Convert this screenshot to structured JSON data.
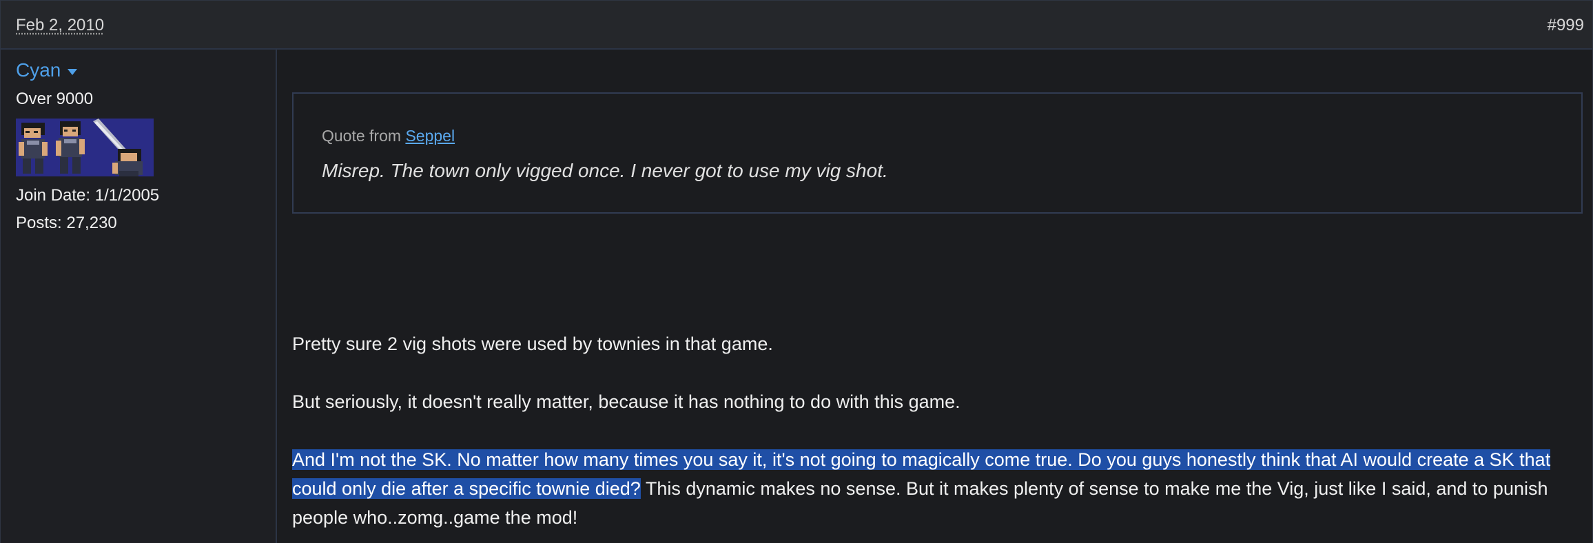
{
  "header": {
    "date": "Feb 2, 2010",
    "post_number": "#999"
  },
  "user": {
    "name": "Cyan",
    "rank": "Over 9000",
    "join_date": "Join Date: 1/1/2005",
    "posts": "Posts: 27,230"
  },
  "quote": {
    "prefix": "Quote from ",
    "author": "Seppel",
    "text": "Misrep. The town only vigged once. I never got to use my vig shot."
  },
  "body": {
    "para1": "Pretty sure 2 vig shots were used by townies in that game.",
    "para2": "But seriously, it doesn't really matter, because it has nothing to do with this game.",
    "para3_highlighted": "And I'm not the SK. No matter how many times you say it, it's not going to magically come true. Do you guys honestly think that AI would create a SK that could only die after a specific townie died?",
    "para3_rest": " This dynamic makes no sense. But it makes plenty of sense to make me the Vig, just like I said, and to punish people who..zomg..game the mod!"
  },
  "colors": {
    "link": "#4e9fe8",
    "selection": "#1f4fa6",
    "avatar_bg": "#2a2c86"
  }
}
